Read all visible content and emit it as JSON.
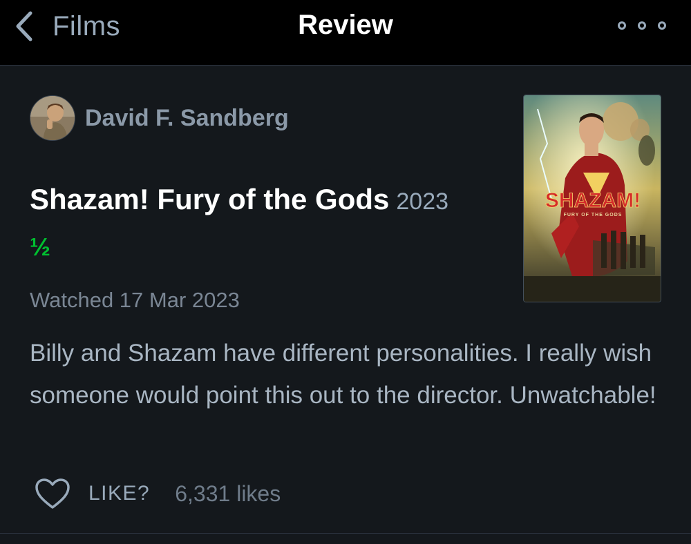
{
  "nav": {
    "back_label": "Films",
    "title": "Review",
    "more_icon": "ellipsis-icon"
  },
  "review": {
    "reviewer_name": "David F. Sandberg",
    "film_title": "Shazam! Fury of the Gods",
    "film_year": "2023",
    "rating": "½",
    "watched": "Watched 17 Mar 2023",
    "body": "Billy and Shazam have different personalities. I really wish someone would point this out to the director. Unwatchable!",
    "poster_logo": "SHAZAM!",
    "poster_subtitle": "FURY OF THE GODS"
  },
  "actions": {
    "like_label": "LIKE?",
    "likes_count": "6,331 likes"
  },
  "colors": {
    "background": "#14181c",
    "nav_background": "#000000",
    "accent_green": "#00c030",
    "muted_text": "#99aabb"
  }
}
